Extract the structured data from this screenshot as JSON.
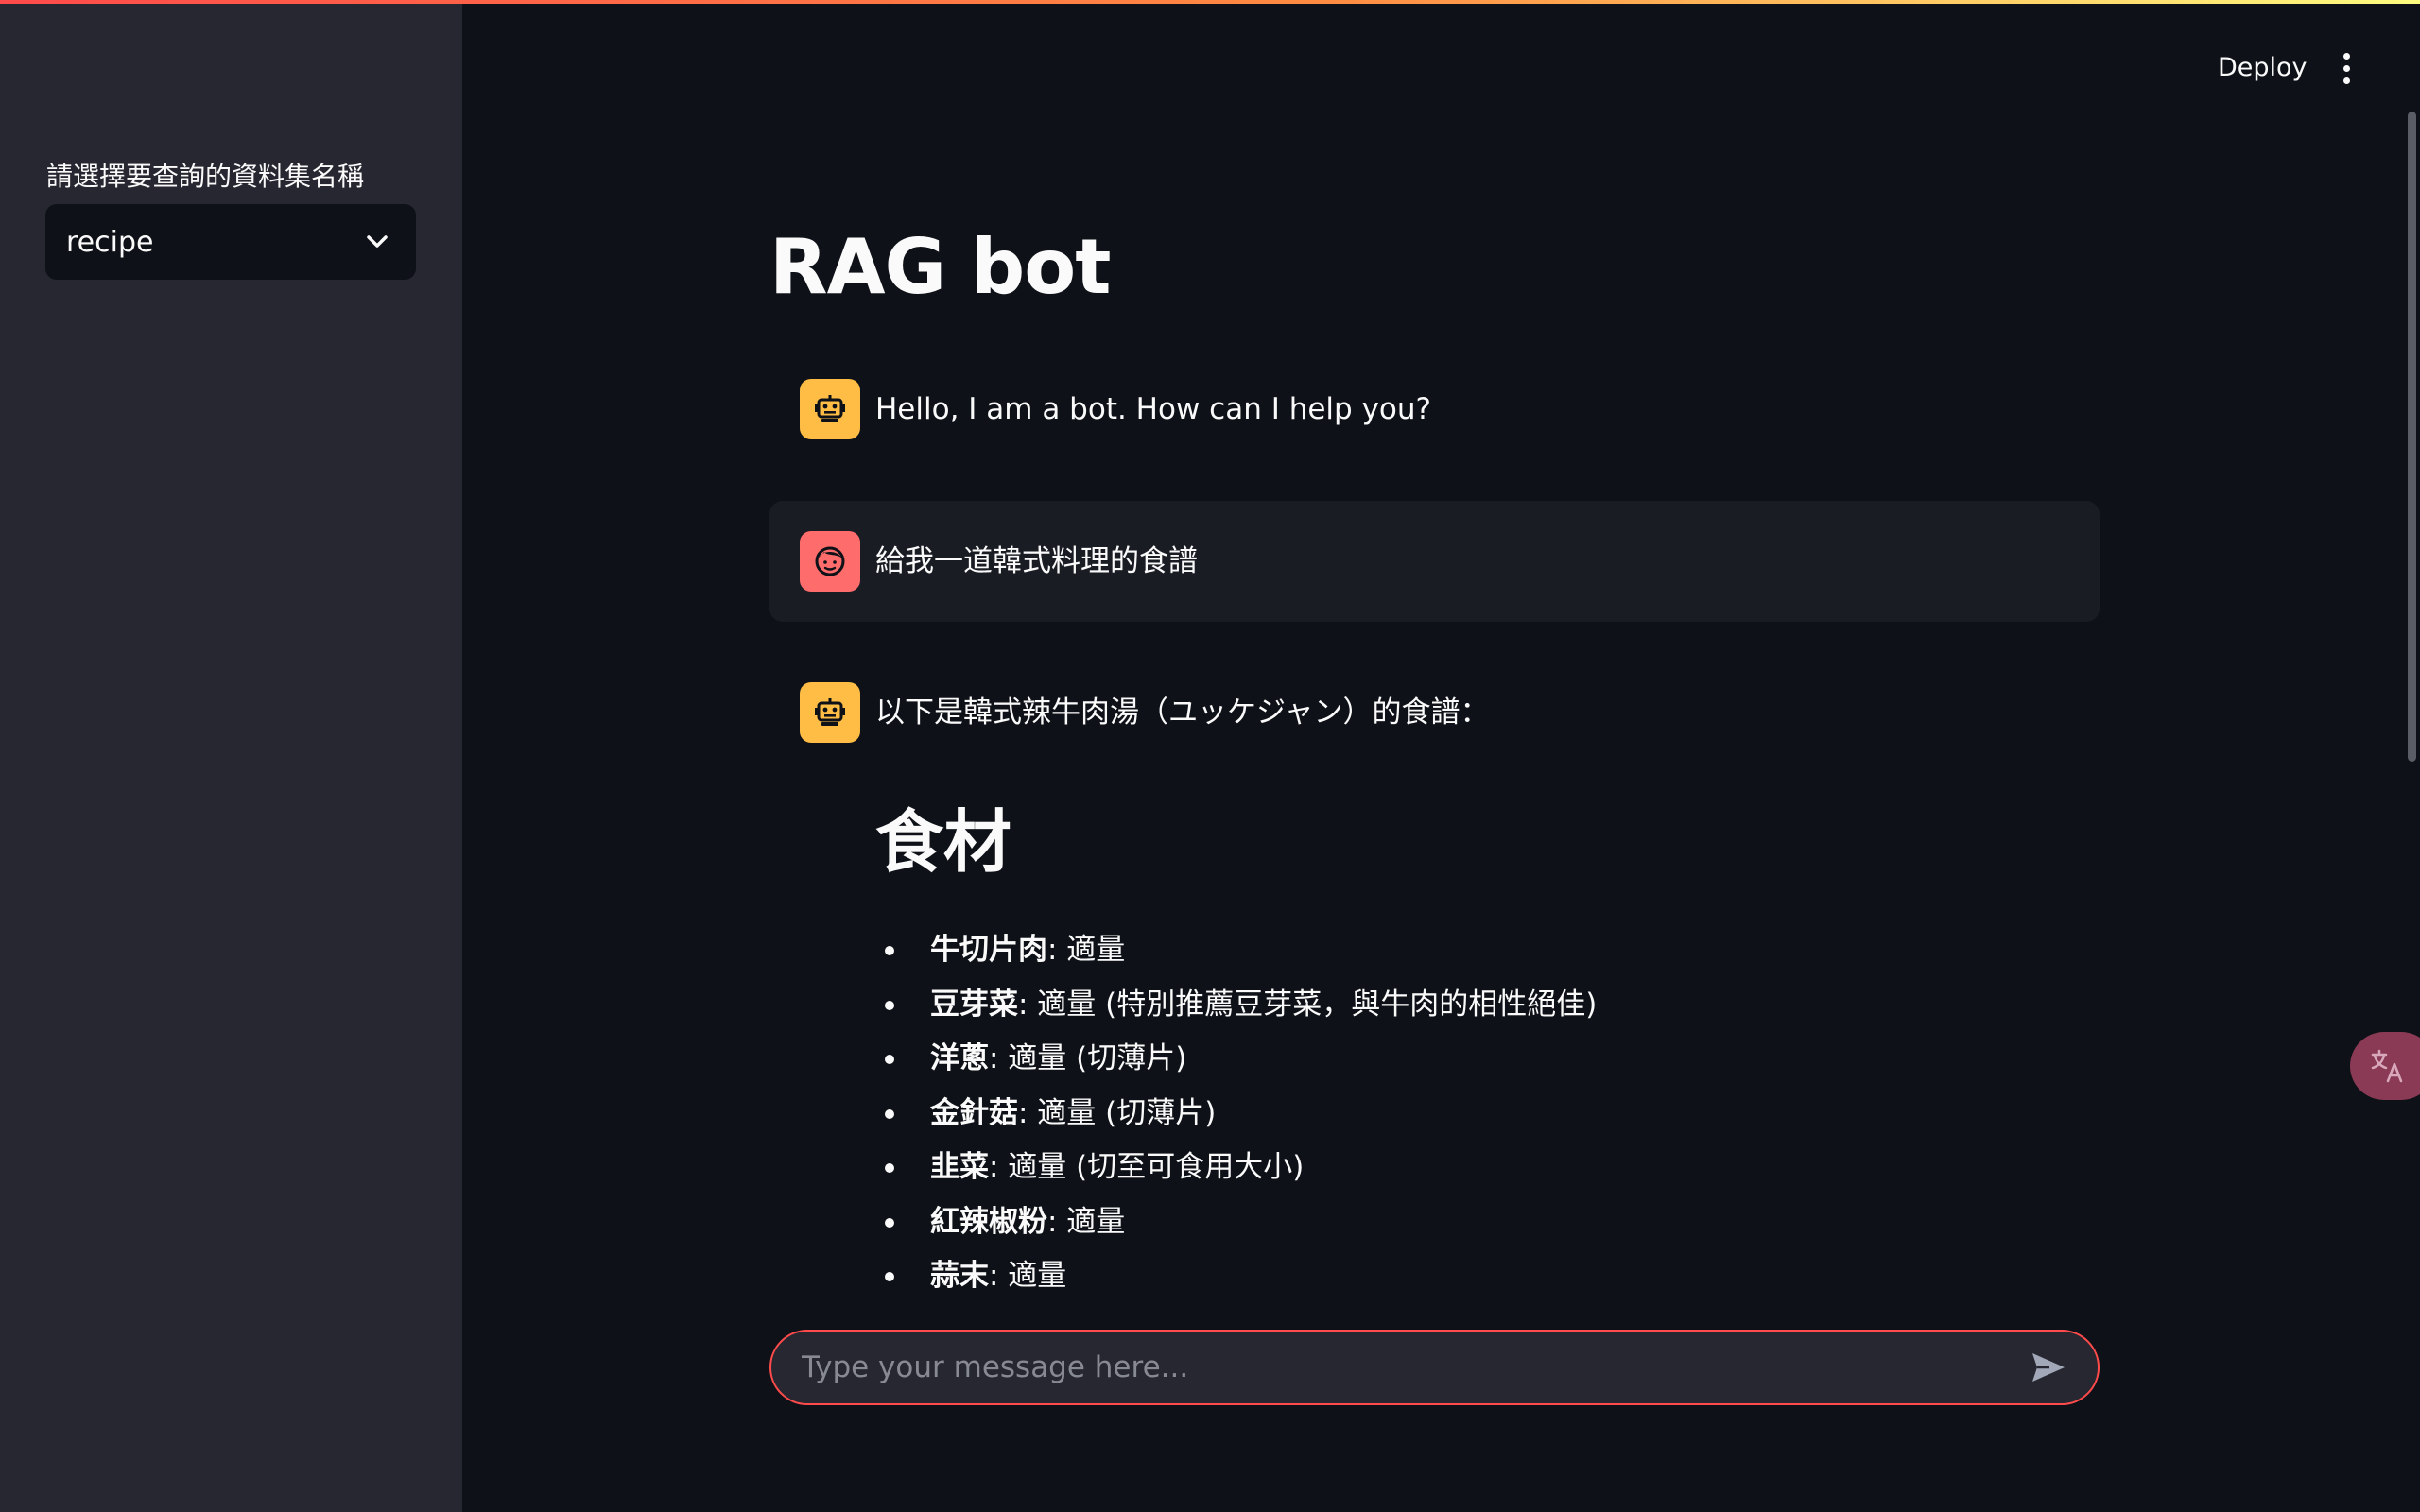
{
  "sidebar": {
    "select_label": "請選擇要查詢的資料集名稱",
    "selected_dataset": "recipe"
  },
  "header": {
    "deploy_label": "Deploy"
  },
  "main": {
    "title": "RAG bot",
    "messages": [
      {
        "role": "assistant",
        "text": "Hello, I am a bot. How can I help you?"
      },
      {
        "role": "user",
        "text": "給我一道韓式料理的食譜"
      },
      {
        "role": "assistant",
        "intro": "以下是韓式辣牛肉湯（ユッケジャン）的食譜：",
        "heading": "食材",
        "ingredients": [
          {
            "name": "牛切片肉",
            "detail": ": 適量"
          },
          {
            "name": "豆芽菜",
            "detail": ": 適量 (特別推薦豆芽菜，與牛肉的相性絕佳)"
          },
          {
            "name": "洋蔥",
            "detail": ": 適量 (切薄片)"
          },
          {
            "name": "金針菇",
            "detail": ": 適量 (切薄片)"
          },
          {
            "name": "韭菜",
            "detail": ": 適量 (切至可食用大小)"
          },
          {
            "name": "紅辣椒粉",
            "detail": ": 適量"
          },
          {
            "name": "蒜末",
            "detail": ": 適量"
          }
        ]
      }
    ]
  },
  "chat_input": {
    "placeholder": "Type your message here..."
  },
  "icons": {
    "bot": "robot-icon",
    "user": "user-face-icon",
    "send": "send-icon",
    "menu": "kebab-menu-icon",
    "translate": "translate-icon",
    "chevron": "chevron-down-icon"
  },
  "colors": {
    "accent": "#ff4b4b",
    "bot_avatar": "#ffbd45",
    "user_avatar": "#ff6c6c",
    "background": "#0e1117",
    "sidebar": "#262730"
  }
}
